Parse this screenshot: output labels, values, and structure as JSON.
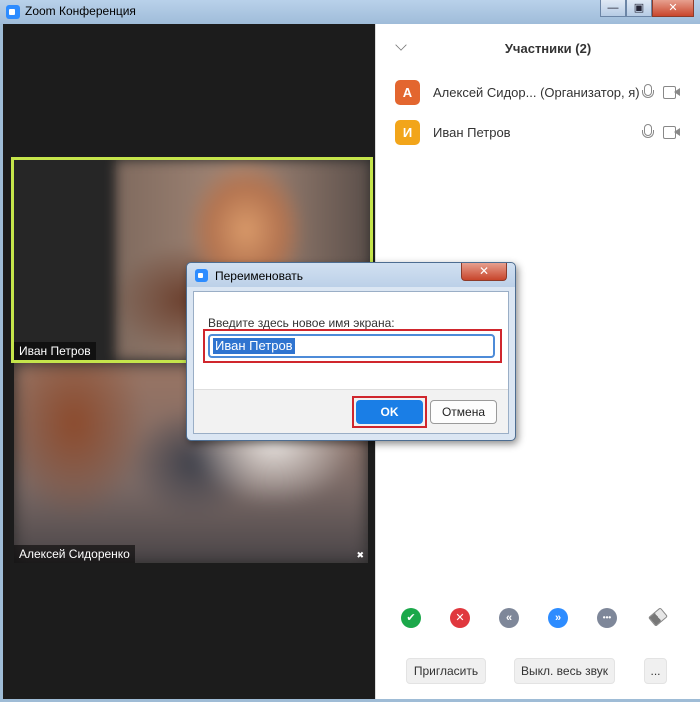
{
  "window": {
    "title": "Zoom Конференция",
    "minimize_glyph": "—",
    "maximize_glyph": "▣",
    "close_glyph": "✕"
  },
  "videos": [
    {
      "name": "Иван Петров",
      "active_speaker": true
    },
    {
      "name": "Алексей Сидоренко",
      "active_speaker": false
    }
  ],
  "participants_panel": {
    "title": "Участники (2)",
    "participants": [
      {
        "initial": "А",
        "name": "Алексей Сидор... (Организатор, я)",
        "avatar_color": "#e3662f"
      },
      {
        "initial": "И",
        "name": "Иван Петров",
        "avatar_color": "#f2a51a"
      }
    ],
    "action_icons": [
      {
        "icon": "check-icon",
        "glyph": "✔",
        "color": "#1ba84a"
      },
      {
        "icon": "close-icon",
        "glyph": "✕",
        "color": "#e0383e"
      },
      {
        "icon": "rewind-icon",
        "glyph": "«",
        "color": "#7e8799"
      },
      {
        "icon": "fast-forward-icon",
        "glyph": "»",
        "color": "#2d8cff"
      },
      {
        "icon": "more-icon",
        "glyph": "•••",
        "color": "#7e8799"
      },
      {
        "icon": "eraser-icon",
        "glyph": "",
        "color": "#777777"
      }
    ],
    "invite_label": "Пригласить",
    "mute_all_label": "Выкл. весь звук",
    "more_label": "..."
  },
  "rename_dialog": {
    "title": "Переименовать",
    "close_glyph": "✕",
    "prompt": "Введите здесь новое имя экрана:",
    "input_value": "Иван Петров",
    "ok_label": "OK",
    "cancel_label": "Отмена"
  }
}
